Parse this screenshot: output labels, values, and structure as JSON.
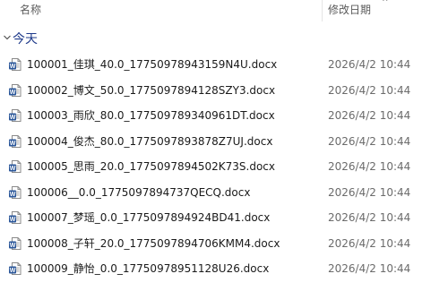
{
  "columns": {
    "name": "名称",
    "modified": "修改日期",
    "sort_indicator": "^"
  },
  "group": {
    "label": "今天",
    "expanded": true
  },
  "file_icon": "word-document-icon",
  "accent_color": "#2b579a",
  "files": [
    {
      "name": "100001_佳琪_40.0_17750978943159N4U.docx",
      "modified": "2026/4/2 10:44"
    },
    {
      "name": "100002_博文_50.0_1775097894128SZY3.docx",
      "modified": "2026/4/2 10:44"
    },
    {
      "name": "100003_雨欣_80.0_177509789340961DT.docx",
      "modified": "2026/4/2 10:44"
    },
    {
      "name": "100004_俊杰_80.0_1775097893878Z7UJ.docx",
      "modified": "2026/4/2 10:44"
    },
    {
      "name": "100005_思雨_20.0_1775097894502K73S.docx",
      "modified": "2026/4/2 10:44"
    },
    {
      "name": "100006__0.0_1775097894737QECQ.docx",
      "modified": "2026/4/2 10:44"
    },
    {
      "name": "100007_梦瑶_0.0_1775097894924BD41.docx",
      "modified": "2026/4/2 10:44"
    },
    {
      "name": "100008_子轩_20.0_1775097894706KMM4.docx",
      "modified": "2026/4/2 10:44"
    },
    {
      "name": "100009_静怡_0.0_17750978951128U26.docx",
      "modified": "2026/4/2 10:44"
    }
  ]
}
